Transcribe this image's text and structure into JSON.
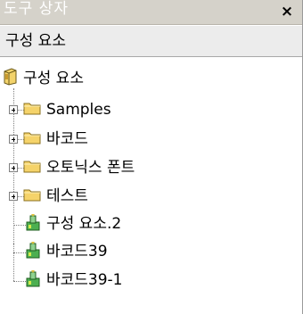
{
  "titlebar": {
    "title": "도구 상자",
    "close_label": "×"
  },
  "header": {
    "label": "구성 요소"
  },
  "tree": {
    "root": {
      "label": "구성 요소",
      "icon": "book-icon"
    },
    "folders": [
      {
        "label": "Samples",
        "icon": "folder-icon",
        "expand": "+"
      },
      {
        "label": "바코드",
        "icon": "folder-icon",
        "expand": "+"
      },
      {
        "label": "오토닉스 폰트",
        "icon": "folder-icon",
        "expand": "+"
      },
      {
        "label": "테스트",
        "icon": "folder-icon",
        "expand": "+"
      }
    ],
    "items": [
      {
        "label": "구성 요소.2",
        "icon": "component-icon"
      },
      {
        "label": "바코드39",
        "icon": "component-icon"
      },
      {
        "label": "바코드39-1",
        "icon": "component-icon"
      }
    ]
  },
  "colors": {
    "titlebar_bg": "#d5d2ca",
    "header_bg": "#ececec",
    "folder_yellow": "#f5d36a",
    "component_green": "#3a9a3a"
  }
}
